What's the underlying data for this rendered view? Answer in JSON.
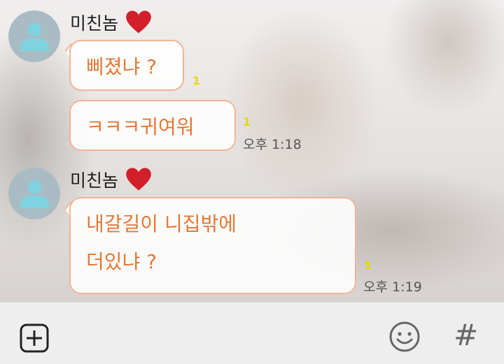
{
  "messages": [
    {
      "sender": "미친놈",
      "bubbles": [
        {
          "text": "삐졌냐 ?",
          "unread": "1"
        },
        {
          "text": "ㅋㅋㅋ귀여워",
          "unread": "1",
          "time": "오후 1:18"
        }
      ]
    },
    {
      "sender": "미친놈",
      "bubbles": [
        {
          "lines": [
            "내갈길이 니집밖에",
            "더있냐 ?"
          ],
          "unread": "1",
          "time": "오후 1:19"
        }
      ]
    }
  ],
  "colors": {
    "bubble_text": "#e57734",
    "bubble_border": "#f3b493",
    "unread_count": "#e6d700",
    "heart": "#d21f2a",
    "avatar_bg": "#a9bcc3",
    "avatar_figure": "#7fd3e0"
  },
  "bottom_bar": {
    "icons": [
      "add-icon",
      "emoji-icon",
      "hashtag-icon"
    ],
    "hashtag_label": "#"
  }
}
